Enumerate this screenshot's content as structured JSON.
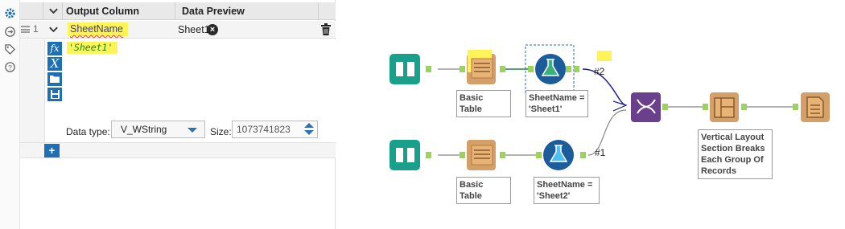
{
  "panel": {
    "headers": {
      "output_column": "Output Column",
      "data_preview": "Data Preview"
    },
    "row": {
      "number": "1",
      "output_column": "SheetName",
      "preview": "Sheet1",
      "expression": "'Sheet1'"
    },
    "toolbar_icons": [
      "fx-icon",
      "variable-icon",
      "open-folder-icon",
      "save-icon"
    ],
    "data_type_label": "Data type:",
    "data_type": "V_WString",
    "size_label": "Size:",
    "size_value": "1073741823",
    "add_label": "+"
  },
  "canvas": {
    "labels": {
      "basic_table_top": "Basic Table",
      "formula_top": "SheetName = 'Sheet1'",
      "basic_table_bottom": "Basic Table",
      "formula_bottom": "SheetName = 'Sheet2'",
      "layout": "Vertical Layout Section Breaks Each Group Of Records"
    },
    "connections": {
      "top": "#2",
      "bottom": "#1"
    }
  },
  "colors": {
    "accent_blue": "#1f6fb5",
    "highlight": "#fff35a",
    "input_tool": "#18a08a",
    "report_tool": "#d4a06a",
    "formula_tool": "#1d5c9b",
    "union_tool": "#6a3f8c",
    "anchor": "#9bd45a"
  }
}
